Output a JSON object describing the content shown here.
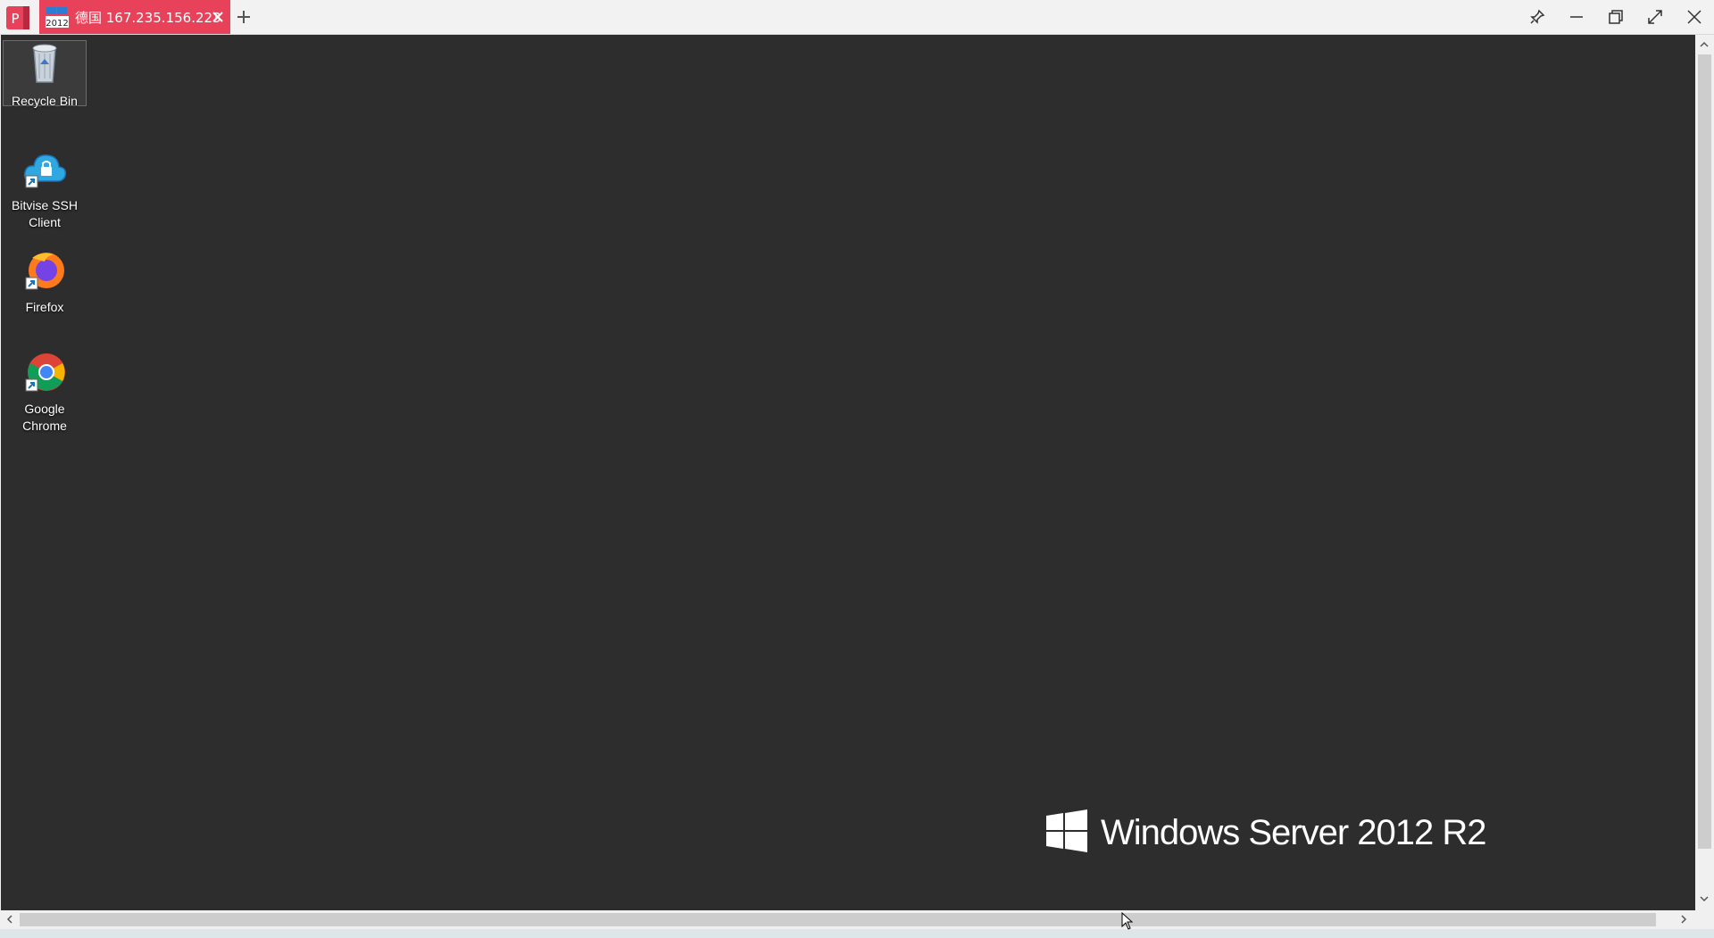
{
  "window": {
    "tab_title": "德国 167.235.156.223",
    "tab_badge": "2012",
    "app_logo_letter": "P",
    "accent_color": "#e8425b"
  },
  "controls": [
    "pin-icon",
    "minimize-icon",
    "restore-icon",
    "fullscreen-icon",
    "close-icon"
  ],
  "desktop": {
    "background": "#2d2d2d",
    "icons": [
      {
        "label": "Recycle Bin",
        "icon": "recycle-bin-icon"
      },
      {
        "label": "Bitvise SSH Client",
        "icon": "bitvise-ssh-icon"
      },
      {
        "label": "Firefox",
        "icon": "firefox-icon"
      },
      {
        "label": "Google Chrome",
        "icon": "chrome-icon"
      }
    ],
    "branding": "Windows Server 2012 R2"
  }
}
